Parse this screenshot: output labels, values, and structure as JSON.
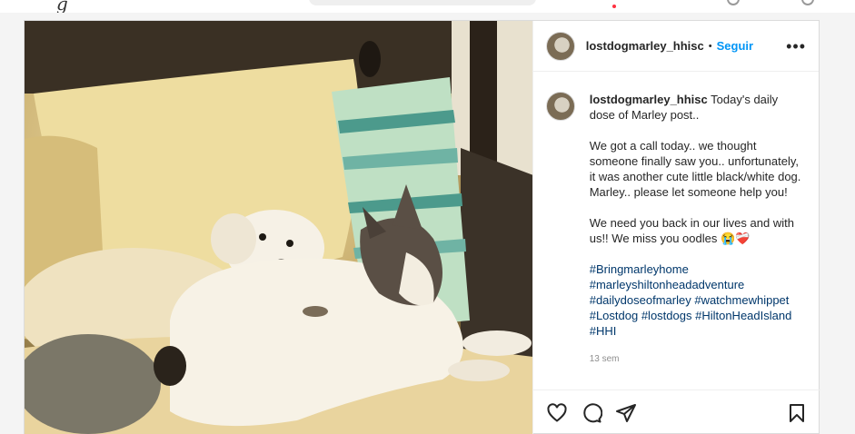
{
  "post": {
    "username": "lostdogmarley_hhisc",
    "separator": "•",
    "follow_label": "Seguir",
    "more_label": "•••",
    "caption": {
      "intro": "Today's daily dose of Marley post..",
      "paragraph_1": "We got a call today.. we thought someone finally saw you.. unfortunately, it was another cute little black/white dog. Marley.. please let someone help you!",
      "paragraph_2": "We need you back in our lives and with us!! We miss you oodles 😭❤️‍🩹",
      "hashtags": [
        "#Bringmarleyhome",
        "#marleyshiltonheadadventure",
        "#dailydoseofmarley #watchmewhippet",
        "#Lostdog #lostdogs #HiltonHeadIsland",
        "#HHI"
      ],
      "timestamp": "13 sem"
    },
    "icons": {
      "like": "heart-icon",
      "comment": "comment-icon",
      "share": "share-icon",
      "save": "bookmark-icon"
    }
  },
  "colors": {
    "link_blue": "#0095f6",
    "hashtag_blue": "#00376b",
    "muted_text": "#8e8e8e"
  }
}
